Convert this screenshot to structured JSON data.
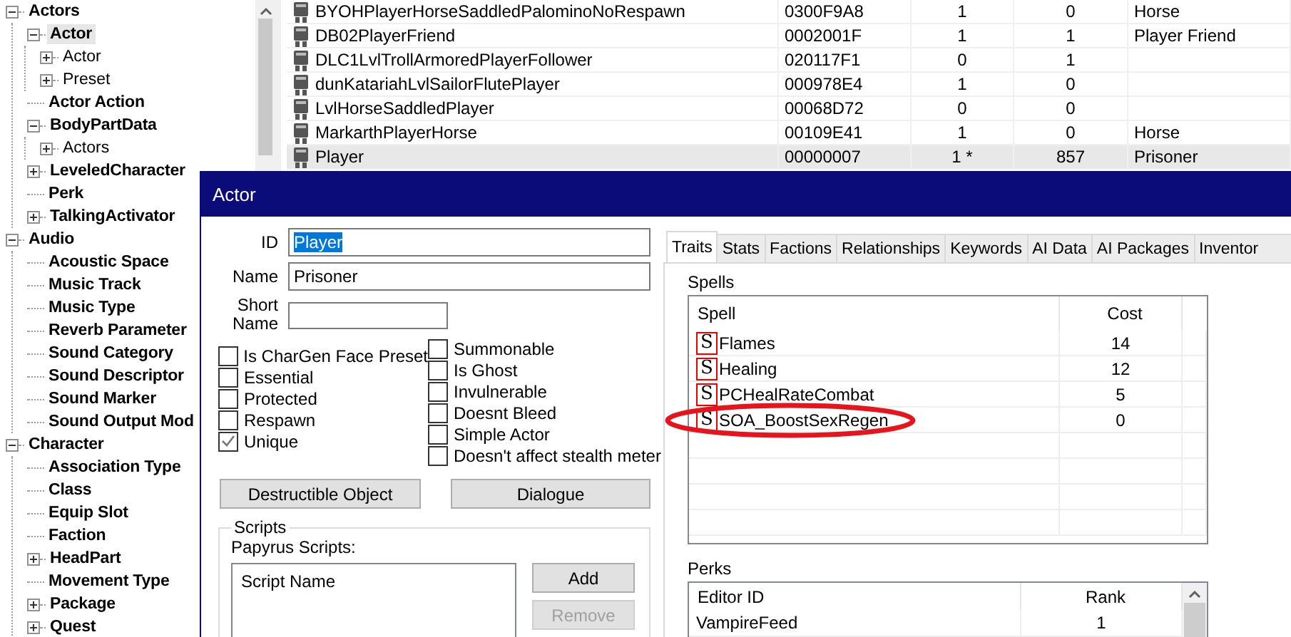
{
  "tree": [
    {
      "label": "Actors",
      "kind": "group",
      "expanded": true,
      "bold": true,
      "selected": false,
      "children": [
        {
          "label": "Actor",
          "kind": "group",
          "expanded": true,
          "bold": true,
          "selected": true,
          "children": [
            {
              "label": "Actor",
              "kind": "group",
              "expanded": false,
              "bold": false,
              "selected": false
            },
            {
              "label": "Preset",
              "kind": "group",
              "expanded": false,
              "bold": false,
              "selected": false
            }
          ]
        },
        {
          "label": "Actor Action",
          "kind": "leaf",
          "bold": true,
          "selected": false
        },
        {
          "label": "BodyPartData",
          "kind": "group",
          "expanded": true,
          "bold": true,
          "selected": false,
          "children": [
            {
              "label": "Actors",
              "kind": "group",
              "expanded": false,
              "bold": false,
              "selected": false
            }
          ]
        },
        {
          "label": "LeveledCharacter",
          "kind": "group",
          "expanded": false,
          "bold": true,
          "selected": false
        },
        {
          "label": "Perk",
          "kind": "leaf",
          "bold": true,
          "selected": false
        },
        {
          "label": "TalkingActivator",
          "kind": "group",
          "expanded": false,
          "bold": true,
          "selected": false
        }
      ]
    },
    {
      "label": "Audio",
      "kind": "group",
      "expanded": true,
      "bold": true,
      "selected": false,
      "children": [
        {
          "label": "Acoustic Space",
          "kind": "leaf",
          "bold": true,
          "selected": false
        },
        {
          "label": "Music Track",
          "kind": "leaf",
          "bold": true,
          "selected": false
        },
        {
          "label": "Music Type",
          "kind": "leaf",
          "bold": true,
          "selected": false
        },
        {
          "label": "Reverb Parameter",
          "kind": "leaf",
          "bold": true,
          "selected": false
        },
        {
          "label": "Sound Category",
          "kind": "leaf",
          "bold": true,
          "selected": false
        },
        {
          "label": "Sound Descriptor",
          "kind": "leaf",
          "bold": true,
          "selected": false
        },
        {
          "label": "Sound Marker",
          "kind": "leaf",
          "bold": true,
          "selected": false
        },
        {
          "label": "Sound Output Mod",
          "kind": "leaf",
          "bold": true,
          "selected": false
        }
      ]
    },
    {
      "label": "Character",
      "kind": "group",
      "expanded": true,
      "bold": true,
      "selected": false,
      "children": [
        {
          "label": "Association Type",
          "kind": "leaf",
          "bold": true,
          "selected": false
        },
        {
          "label": "Class",
          "kind": "leaf",
          "bold": true,
          "selected": false
        },
        {
          "label": "Equip Slot",
          "kind": "leaf",
          "bold": true,
          "selected": false
        },
        {
          "label": "Faction",
          "kind": "leaf",
          "bold": true,
          "selected": false
        },
        {
          "label": "HeadPart",
          "kind": "group",
          "expanded": false,
          "bold": true,
          "selected": false
        },
        {
          "label": "Movement Type",
          "kind": "leaf",
          "bold": true,
          "selected": false
        },
        {
          "label": "Package",
          "kind": "group",
          "expanded": false,
          "bold": true,
          "selected": false
        },
        {
          "label": "Quest",
          "kind": "group",
          "expanded": false,
          "bold": true,
          "selected": false
        }
      ]
    }
  ],
  "actor_list": {
    "rows": [
      {
        "cells": [
          "BYOHPlayerHorseSaddledPalominoNoRespawn",
          "0300F9A8",
          "1",
          "0",
          "Horse"
        ],
        "selected": false
      },
      {
        "cells": [
          "DB02PlayerFriend",
          "0002001F",
          "1",
          "1",
          "Player Friend"
        ],
        "selected": false
      },
      {
        "cells": [
          "DLC1LvlTrollArmoredPlayerFollower",
          "020117F1",
          "0",
          "1"
        ],
        "selected": false
      },
      {
        "cells": [
          "dunKatariahLvlSailorFlutePlayer",
          "000978E4",
          "1",
          "0"
        ],
        "selected": false
      },
      {
        "cells": [
          "LvlHorseSaddledPlayer",
          "00068D72",
          "0",
          "0"
        ],
        "selected": false
      },
      {
        "cells": [
          "MarkarthPlayerHorse",
          "00109E41",
          "1",
          "0",
          "Horse"
        ],
        "selected": false
      },
      {
        "cells": [
          "Player",
          "00000007",
          "1 *",
          "857",
          "Prisoner"
        ],
        "selected": true
      }
    ]
  },
  "dialog": {
    "title": "Actor",
    "fields": [
      {
        "label": "ID",
        "value": "Player",
        "highlighted": true
      },
      {
        "label": "Name",
        "value": "Prisoner",
        "highlighted": false
      },
      {
        "label": "Short Name"
      }
    ],
    "flags_left": [
      {
        "label": "Is CharGen Face Preset",
        "checked": false
      },
      {
        "label": "Essential",
        "checked": false
      },
      {
        "label": "Protected",
        "checked": false
      },
      {
        "label": "Respawn",
        "checked": false
      },
      {
        "label": "Unique",
        "checked": true
      }
    ],
    "flags_right": [
      {
        "label": "Summonable",
        "checked": false
      },
      {
        "label": "Is Ghost",
        "checked": false
      },
      {
        "label": "Invulnerable",
        "checked": false
      },
      {
        "label": "Doesnt Bleed",
        "checked": false
      },
      {
        "label": "Simple Actor",
        "checked": false
      },
      {
        "label": "Doesn't affect stealth meter",
        "checked": false
      }
    ],
    "buttons": [
      "Destructible Object",
      "Dialogue"
    ],
    "scripts": {
      "title": "Scripts",
      "label": "Papyrus Scripts:",
      "column": "Script Name",
      "buttons": [
        {
          "label": "Add",
          "disabled": false
        },
        {
          "label": "Remove",
          "disabled": true
        }
      ]
    },
    "tabs": [
      {
        "label": "Traits",
        "selected": true
      },
      {
        "label": "Stats",
        "selected": false
      },
      {
        "label": "Factions",
        "selected": false
      },
      {
        "label": "Relationships",
        "selected": false
      },
      {
        "label": "Keywords",
        "selected": false
      },
      {
        "label": "AI Data",
        "selected": false
      },
      {
        "label": "AI Packages",
        "selected": false
      },
      {
        "label": "Inventor",
        "selected": false
      }
    ],
    "spells": {
      "title": "Spells",
      "columns": [
        "Spell",
        "Cost"
      ],
      "rows": [
        {
          "icon": "S",
          "name": "Flames",
          "cost": "14",
          "circled": false
        },
        {
          "icon": "S",
          "name": "Healing",
          "cost": "12",
          "circled": false
        },
        {
          "icon": "S",
          "name": "PCHealRateCombat",
          "cost": "5",
          "circled": false
        },
        {
          "icon": "S",
          "name": "SOA_BoostSexRegen",
          "cost": "0",
          "circled": true
        }
      ]
    },
    "perks": {
      "title": "Perks",
      "columns": [
        "Editor ID",
        "Rank"
      ],
      "rows": [
        {
          "name": "VampireFeed",
          "rank": "1"
        }
      ]
    }
  }
}
